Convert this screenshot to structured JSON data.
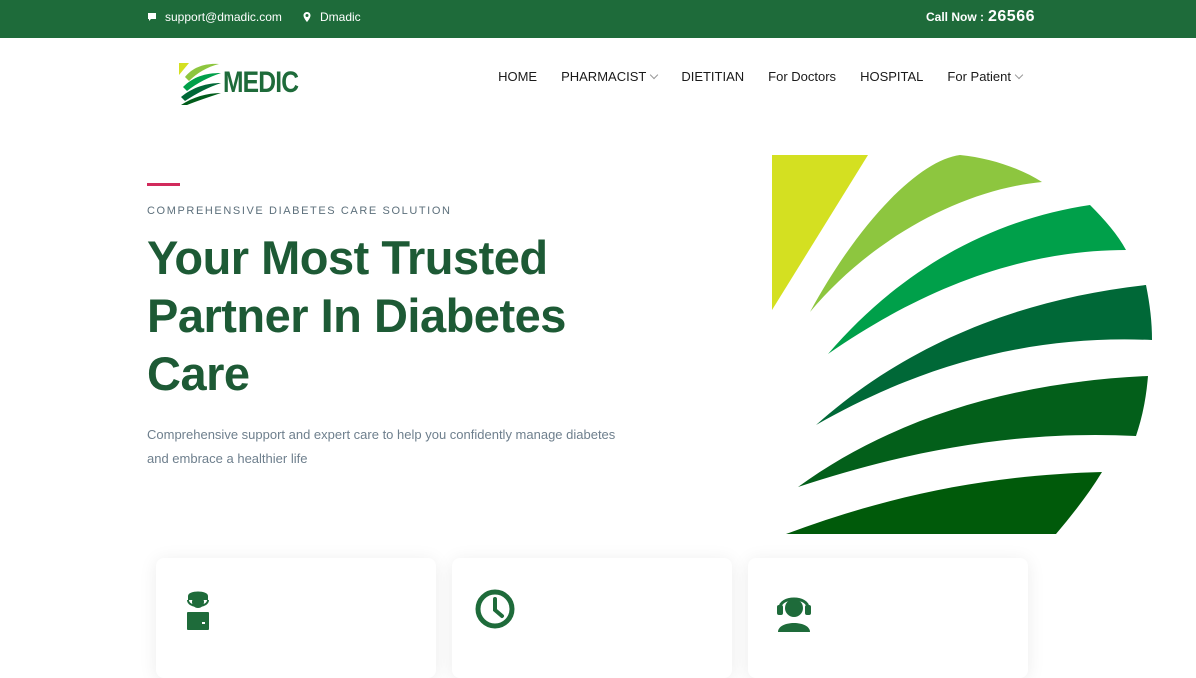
{
  "topbar": {
    "email": "support@dmadic.com",
    "location": "Dmadic",
    "call_label": "Call Now :",
    "call_number": "26566"
  },
  "logo": {
    "text": "MEDIC"
  },
  "nav": {
    "items": [
      {
        "label": "HOME"
      },
      {
        "label": "PHARMACIST"
      },
      {
        "label": "DIETITIAN"
      },
      {
        "label": "For Doctors"
      },
      {
        "label": "HOSPITAL"
      },
      {
        "label": "For Patient"
      }
    ]
  },
  "hero": {
    "eyebrow": "COMPREHENSIVE DIABETES CARE SOLUTION",
    "headline_line1": "Your Most Trusted",
    "headline_line2": "Partner In Diabetes",
    "headline_line3": "Care",
    "subtext": "Comprehensive support and expert care to help you confidently manage diabetes and embrace a healthier life"
  },
  "cards": [
    {
      "icon": "nurse-icon"
    },
    {
      "icon": "clock-icon"
    },
    {
      "icon": "support-agent-icon"
    }
  ],
  "colors": {
    "brand_dark": "#1e6b3a",
    "headline": "#1d5a35",
    "accent": "#d12a5c",
    "lime": "#d4e021",
    "light_green": "#8dc63f",
    "mid_green": "#00a04a",
    "deep_green": "#006837"
  }
}
